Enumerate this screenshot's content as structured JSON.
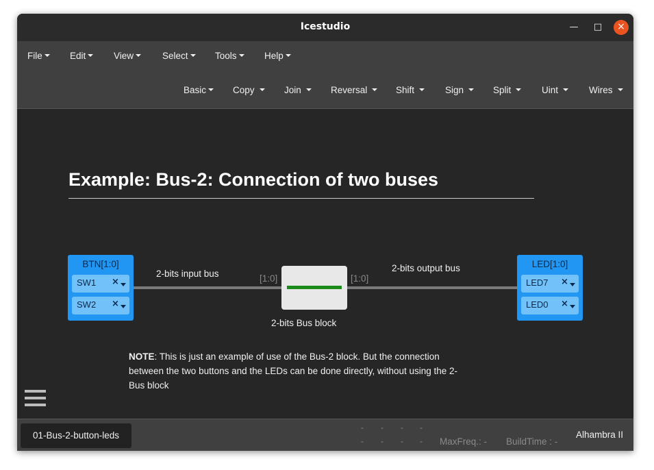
{
  "window": {
    "title": "Icestudio",
    "controls": {
      "minimize": "—",
      "maximize": "□",
      "close": "×"
    }
  },
  "menubar": [
    "File",
    "Edit",
    "View",
    "Select",
    "Tools",
    "Help"
  ],
  "toolbar": [
    "Basic",
    "Copy",
    "Join",
    "Reversal",
    "Shift",
    "Sign",
    "Split",
    "Uint",
    "Wires"
  ],
  "canvas": {
    "heading": "Example: Bus-2: Connection of two buses",
    "input_block": {
      "label": "BTN[1:0]",
      "pins": [
        "SW1",
        "SW2"
      ]
    },
    "output_block": {
      "label": "LED[1:0]",
      "pins": [
        "LED7",
        "LED0"
      ]
    },
    "input_bus_label": "2-bits input bus",
    "output_bus_label": "2-bits output bus",
    "bus_block_label": "2-bits Bus block",
    "port_in_label": "[1:0]",
    "port_out_label": "[1:0]",
    "pin_remove_glyph": "×",
    "note": {
      "bold": "NOTE",
      "text": ": This is just an example of use of the Bus-2 block. But the connection between the two buttons and the LEDs can be done directly, without using the 2-Bus block"
    }
  },
  "statusbar": {
    "file_tab": "01-Bus-2-button-leds",
    "dash": "-",
    "maxfreq_label": "MaxFreq.:",
    "maxfreq_value": "-",
    "buildtime_label": "BuildTime :",
    "buildtime_value": "-",
    "board": "Alhambra II"
  },
  "colors": {
    "io_block": "#2196f3",
    "io_pin": "#72c1f9",
    "bus_wire": "#7a7a7a",
    "bus_block_bar": "#1a8a1a",
    "close_button": "#e95420",
    "canvas_bg": "#262626",
    "menubar_bg": "#404040"
  }
}
